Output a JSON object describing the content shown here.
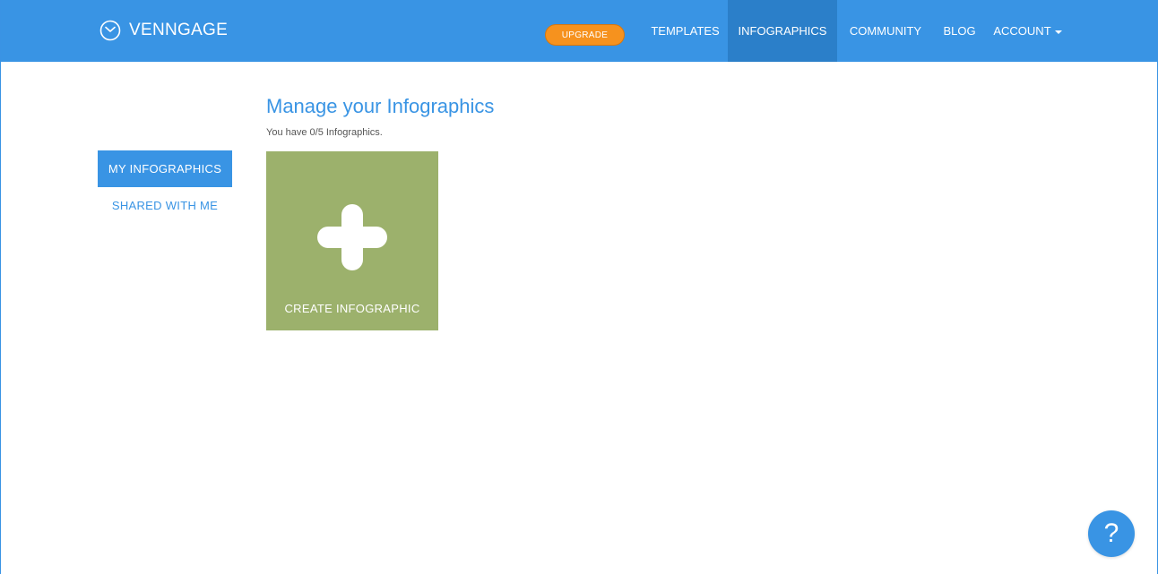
{
  "header": {
    "brand": "VENNGAGE",
    "brand_icon": "venngage-logo-icon",
    "upgrade_label": "UPGRADE",
    "nav": {
      "templates": "TEMPLATES",
      "infographics": "INFOGRAPHICS",
      "community": "COMMUNITY",
      "blog": "BLOG",
      "account": "ACCOUNT"
    },
    "active_nav": "INFOGRAPHICS",
    "account_icon": "caret-down-icon"
  },
  "sidebar": {
    "items": [
      {
        "label": "MY INFOGRAPHICS",
        "active": true
      },
      {
        "label": "SHARED WITH ME",
        "active": false
      }
    ]
  },
  "main": {
    "title": "Manage your Infographics",
    "subtitle": "You have 0/5 Infographics.",
    "create_card": {
      "label": "CREATE INFOGRAPHIC",
      "icon": "plus-icon"
    }
  },
  "help": {
    "label": "?",
    "icon": "help-icon"
  },
  "colors": {
    "primary": "#3994e4",
    "nav_active": "#2b7fc9",
    "upgrade": "#f6921e",
    "create_card": "#9cb16c"
  }
}
